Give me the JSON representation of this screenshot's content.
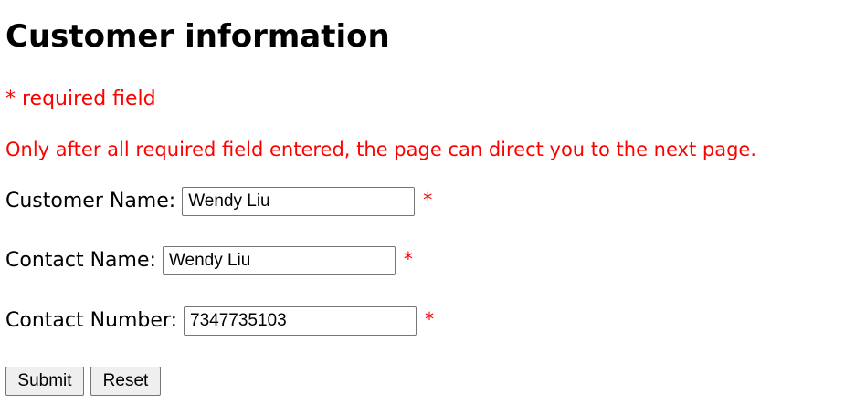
{
  "page": {
    "title": "Customer information",
    "required_note": "* required field",
    "instruction": "Only after all required field entered, the page can direct you to the next page."
  },
  "form": {
    "fields": [
      {
        "label": "Customer Name:",
        "value": "Wendy Liu",
        "required_marker": "*"
      },
      {
        "label": "Contact Name:",
        "value": "Wendy Liu",
        "required_marker": "*"
      },
      {
        "label": "Contact Number:",
        "value": "7347735103",
        "required_marker": "*"
      }
    ],
    "submit_label": "Submit",
    "reset_label": "Reset"
  },
  "colors": {
    "required": "#ff0000",
    "text": "#000000",
    "button_bg": "#efefef",
    "border": "#767676"
  }
}
